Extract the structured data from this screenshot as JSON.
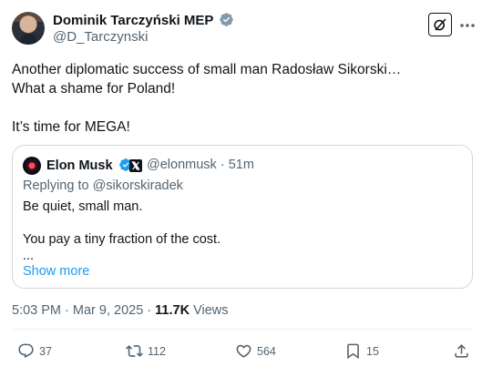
{
  "author": {
    "name": "Dominik Tarczyński MEP",
    "handle": "@D_Tarczynski"
  },
  "tweet": {
    "line1": "Another diplomatic success of small man Radosław Sikorski…",
    "line2": "What a shame for Poland!",
    "line3": "It’s time for MEGA!"
  },
  "quote": {
    "name": "Elon Musk",
    "handle": "@elonmusk",
    "separator": "·",
    "time": "51m",
    "replying": "Replying to @sikorskiradek",
    "body_line1": "Be quiet, small man.",
    "body_line2": "You pay a tiny fraction of the cost.",
    "ellipsis": "...",
    "show_more": "Show more"
  },
  "meta": {
    "time_date": "5:03 PM · Mar 9, 2025 · ",
    "views_count": "11.7K",
    "views_label": " Views"
  },
  "actions": {
    "replies": "37",
    "reposts": "112",
    "likes": "564",
    "bookmarks": "15"
  },
  "colors": {
    "accent": "#1d9bf0",
    "muted": "#536471",
    "text": "#0f1419",
    "border": "#cfd9de"
  }
}
